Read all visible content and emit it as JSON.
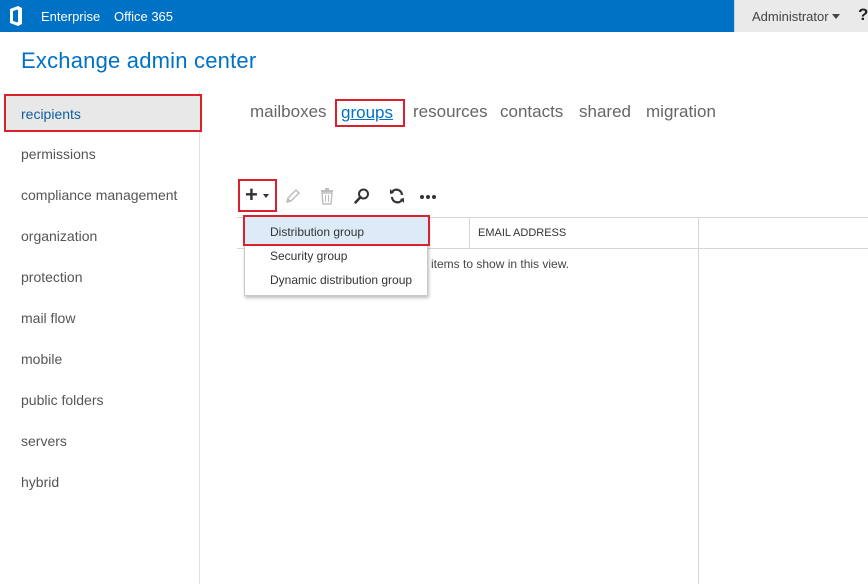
{
  "topbar": {
    "logo_icon": "office-logo-icon",
    "links": [
      "Enterprise",
      "Office 365"
    ],
    "user": "Administrator",
    "help": "?"
  },
  "app_title": "Exchange admin center",
  "leftnav": {
    "items": [
      {
        "label": "recipients",
        "selected": true
      },
      {
        "label": "permissions"
      },
      {
        "label": "compliance management"
      },
      {
        "label": "organization"
      },
      {
        "label": "protection"
      },
      {
        "label": "mail flow"
      },
      {
        "label": "mobile"
      },
      {
        "label": "public folders"
      },
      {
        "label": "servers"
      },
      {
        "label": "hybrid"
      }
    ]
  },
  "tabs": [
    {
      "label": "mailboxes"
    },
    {
      "label": "groups",
      "selected": true
    },
    {
      "label": "resources"
    },
    {
      "label": "contacts"
    },
    {
      "label": "shared"
    },
    {
      "label": "migration"
    }
  ],
  "toolbar": {
    "icons": [
      "add-icon",
      "edit-icon",
      "delete-icon",
      "search-icon",
      "refresh-icon",
      "more-icon"
    ]
  },
  "grid": {
    "columns": [
      "",
      "EMAIL ADDRESS"
    ],
    "empty_message": "items to show in this view."
  },
  "new_menu": {
    "items": [
      {
        "label": "Distribution group",
        "highlighted": true
      },
      {
        "label": "Security group"
      },
      {
        "label": "Dynamic distribution group"
      }
    ]
  },
  "colors": {
    "brand": "#0072c6",
    "highlight_border": "#d9202c",
    "menu_hover": "#dcebf7"
  }
}
